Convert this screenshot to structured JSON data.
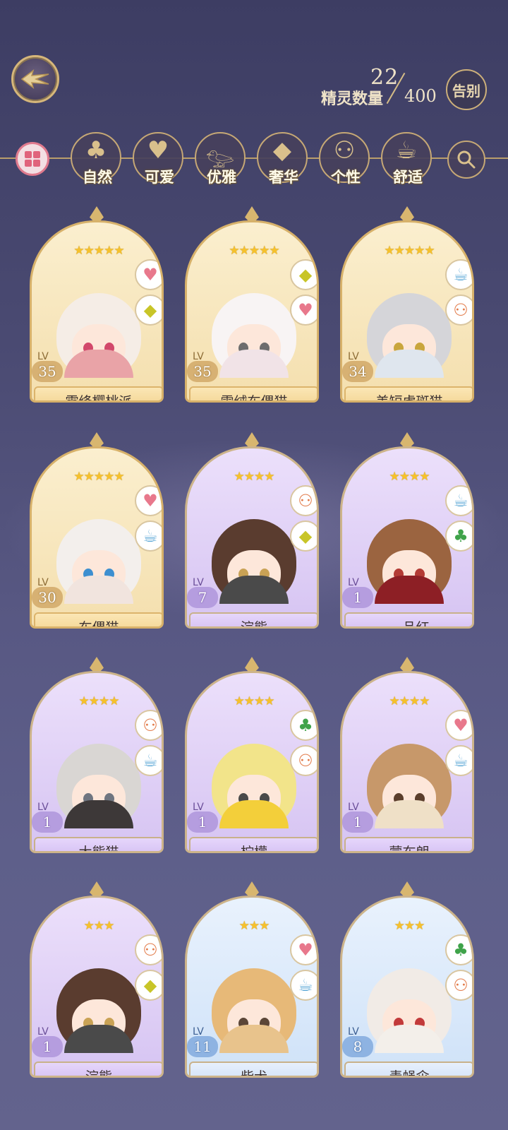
{
  "header": {
    "current_count": "22",
    "count_label": "精灵数量",
    "max_count": "400",
    "farewell_label": "告别"
  },
  "filters": [
    {
      "label": "自然",
      "icon": "clover-icon",
      "glyph": "♣"
    },
    {
      "label": "可爱",
      "icon": "heart-icon",
      "glyph": "♥"
    },
    {
      "label": "优雅",
      "icon": "swan-icon",
      "glyph": "𓅰"
    },
    {
      "label": "奢华",
      "icon": "diamond-icon",
      "glyph": "◆"
    },
    {
      "label": "个性",
      "icon": "glasses-icon",
      "glyph": "⚇"
    },
    {
      "label": "舒适",
      "icon": "teacup-icon",
      "glyph": "☕"
    }
  ],
  "cards": [
    {
      "name": "霜绛樱桃派",
      "level": "35",
      "stars": "★★★★★",
      "frame": "gold",
      "tags": [
        "heart",
        "diamond"
      ],
      "hair": "#f5ede6",
      "eye": "#d2486b",
      "cloth": "#e9a3a7"
    },
    {
      "name": "雪绒布偶猫",
      "level": "35",
      "stars": "★★★★★",
      "frame": "gold",
      "tags": [
        "diamond",
        "heart"
      ],
      "hair": "#f8f4f4",
      "eye": "#6d6d6d",
      "cloth": "#f1e3e7"
    },
    {
      "name": "美短虎斑猫",
      "level": "34",
      "stars": "★★★★★",
      "frame": "gold",
      "tags": [
        "teacup",
        "glasses"
      ],
      "hair": "#d5d5d9",
      "eye": "#c9a63d",
      "cloth": "#dfe6ee"
    },
    {
      "name": "布偶猫",
      "level": "30",
      "stars": "★★★★★",
      "frame": "gold",
      "tags": [
        "heart",
        "teacup"
      ],
      "hair": "#f3efec",
      "eye": "#3d8fd0",
      "cloth": "#f1e4de"
    },
    {
      "name": "浣熊",
      "level": "7",
      "stars": "★★★★",
      "frame": "purple",
      "tags": [
        "glasses",
        "diamond"
      ],
      "hair": "#5a3c2f",
      "eye": "#c9a255",
      "cloth": "#4a4a4a"
    },
    {
      "name": "一品红",
      "level": "1",
      "stars": "★★★★",
      "frame": "purple",
      "tags": [
        "teacup",
        "clover"
      ],
      "hair": "#9b6440",
      "eye": "#b33b35",
      "cloth": "#8d1f25"
    },
    {
      "name": "大熊猫",
      "level": "1",
      "stars": "★★★★",
      "frame": "purple",
      "tags": [
        "glasses",
        "teacup"
      ],
      "hair": "#d9d6d3",
      "eye": "#6f7580",
      "cloth": "#3d3838"
    },
    {
      "name": "柠檬",
      "level": "1",
      "stars": "★★★★",
      "frame": "purple",
      "tags": [
        "clover",
        "glasses"
      ],
      "hair": "#f2e48a",
      "eye": "#4a4a4a",
      "cloth": "#f3cf3a"
    },
    {
      "name": "蒙布朗",
      "level": "1",
      "stars": "★★★★",
      "frame": "purple",
      "tags": [
        "heart",
        "teacup"
      ],
      "hair": "#c7986a",
      "eye": "#5b3e2c",
      "cloth": "#efe0c7"
    },
    {
      "name": "浣熊",
      "level": "1",
      "stars": "★★★",
      "frame": "purple",
      "tags": [
        "glasses",
        "diamond"
      ],
      "hair": "#5a3c2f",
      "eye": "#c9a255",
      "cloth": "#4a4a4a"
    },
    {
      "name": "柴犬",
      "level": "11",
      "stars": "★★★",
      "frame": "blue",
      "tags": [
        "heart",
        "teacup"
      ],
      "hair": "#e7b978",
      "eye": "#5b4637",
      "cloth": "#e8c38c"
    },
    {
      "name": "毒蝇伞",
      "level": "8",
      "stars": "★★★",
      "frame": "blue",
      "tags": [
        "clover",
        "glasses"
      ],
      "hair": "#f1ebe6",
      "eye": "#c23a3a",
      "cloth": "#f3efea"
    }
  ],
  "tag_glyphs": {
    "heart": "♥",
    "diamond": "◆",
    "teacup": "☕",
    "glasses": "⚇",
    "clover": "♣"
  },
  "tag_colors": {
    "heart": "#e8788c",
    "diamond": "#c8c528",
    "teacup": "#5aa7d6",
    "glasses": "#e27b4a",
    "clover": "#3fa34a"
  },
  "lv_label": "LV"
}
